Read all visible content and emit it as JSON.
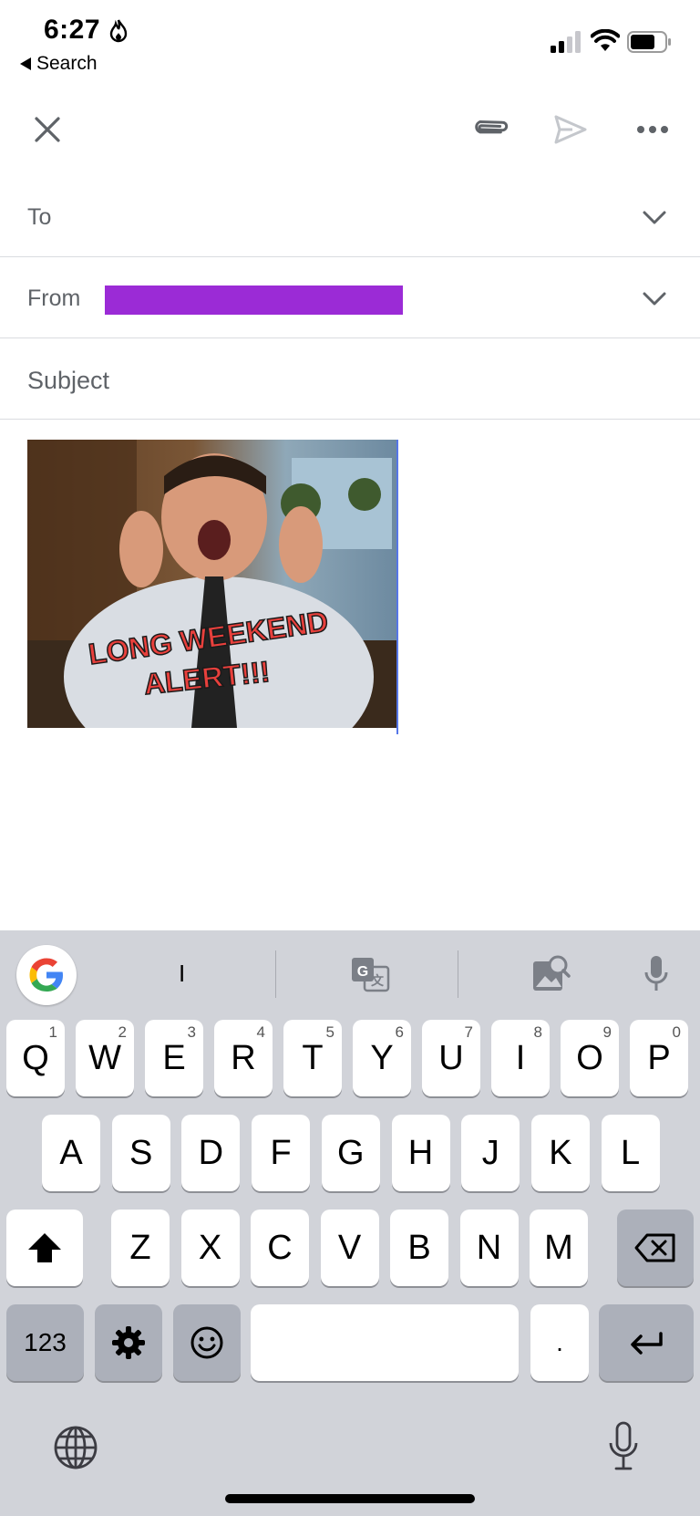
{
  "status_bar": {
    "time": "6:27",
    "back_label": "Search"
  },
  "toolbar": {
    "close_icon": "close-icon",
    "attach_icon": "paperclip-icon",
    "send_icon": "send-icon",
    "more_icon": "more-icon"
  },
  "compose": {
    "to_label": "To",
    "from_label": "From",
    "subject_placeholder": "Subject",
    "gif_caption_line1": "LONG WEEKEND",
    "gif_caption_line2": "ALERT!!!",
    "redaction_color": "#9b2bd6"
  },
  "keyboard": {
    "suggestion": "I",
    "row1": [
      {
        "label": "Q",
        "num": "1"
      },
      {
        "label": "W",
        "num": "2"
      },
      {
        "label": "E",
        "num": "3"
      },
      {
        "label": "R",
        "num": "4"
      },
      {
        "label": "T",
        "num": "5"
      },
      {
        "label": "Y",
        "num": "6"
      },
      {
        "label": "U",
        "num": "7"
      },
      {
        "label": "I",
        "num": "8"
      },
      {
        "label": "O",
        "num": "9"
      },
      {
        "label": "P",
        "num": "0"
      }
    ],
    "row2": [
      "A",
      "S",
      "D",
      "F",
      "G",
      "H",
      "J",
      "K",
      "L"
    ],
    "row3": [
      "Z",
      "X",
      "C",
      "V",
      "B",
      "N",
      "M"
    ],
    "numbers_label": "123",
    "period_label": "."
  }
}
